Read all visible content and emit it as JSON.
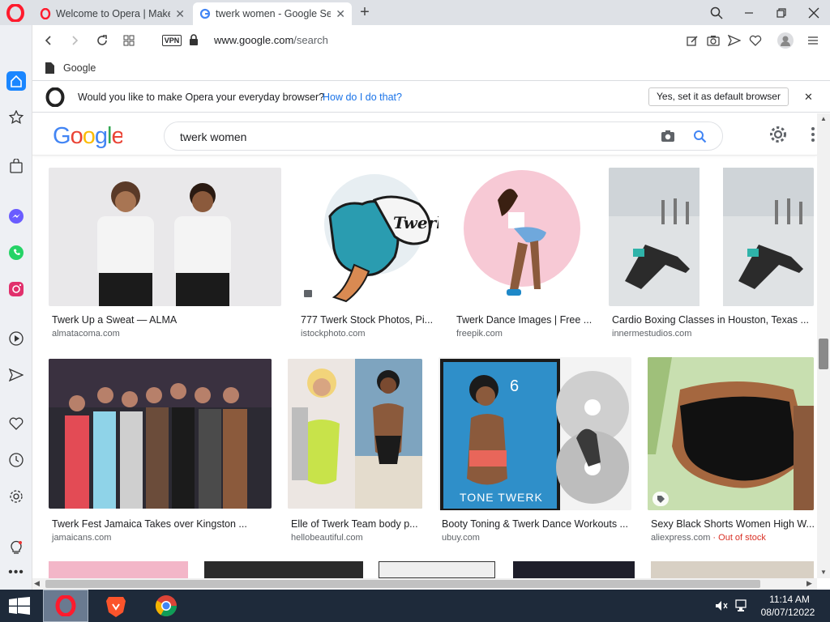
{
  "tabs": [
    {
      "title": "Welcome to Opera | Make",
      "active": false
    },
    {
      "title": "twerk women - Google Sea",
      "active": true
    }
  ],
  "address": {
    "vpn_label": "VPN",
    "url_domain": "www.google.com",
    "url_path": "/search"
  },
  "bookmarks": [
    {
      "label": "Google"
    }
  ],
  "infobar": {
    "message": "Would you like to make Opera your everyday browser?",
    "link": "How do I do that?",
    "button": "Yes, set it as default browser"
  },
  "search": {
    "query": "twerk women"
  },
  "results": {
    "row1": [
      {
        "caption": "Twerk Up a Sweat — ALMA",
        "source": "almatacoma.com"
      },
      {
        "caption": "777 Twerk Stock Photos, Pi...",
        "source": "istockphoto.com"
      },
      {
        "caption": "Twerk Dance Images | Free ...",
        "source": "freepik.com"
      },
      {
        "caption": "Cardio Boxing Classes in Houston, Texas ...",
        "source": "innermestudios.com"
      }
    ],
    "row2": [
      {
        "caption": "Twerk Fest Jamaica Takes over Kingston ...",
        "source": "jamaicans.com"
      },
      {
        "caption": "Elle of Twerk Team body p...",
        "source": "hellobeautiful.com"
      },
      {
        "caption": "Booty Toning & Twerk Dance Workouts ...",
        "source": "ubuy.com"
      },
      {
        "caption": "Sexy Black Shorts Women High W...",
        "source": "aliexpress.com",
        "note": "· Out of stock"
      }
    ],
    "image_texts": {
      "twerk_logo": "Twerk",
      "dvd_title": "TONE TWERK",
      "dvd_number": "6"
    }
  },
  "taskbar": {
    "time": "11:14 AM",
    "date": "08/07/12022"
  },
  "colors": {
    "opera_red": "#ff1b2d",
    "link_blue": "#1a73e8",
    "taskbar": "#1e2a3a"
  }
}
